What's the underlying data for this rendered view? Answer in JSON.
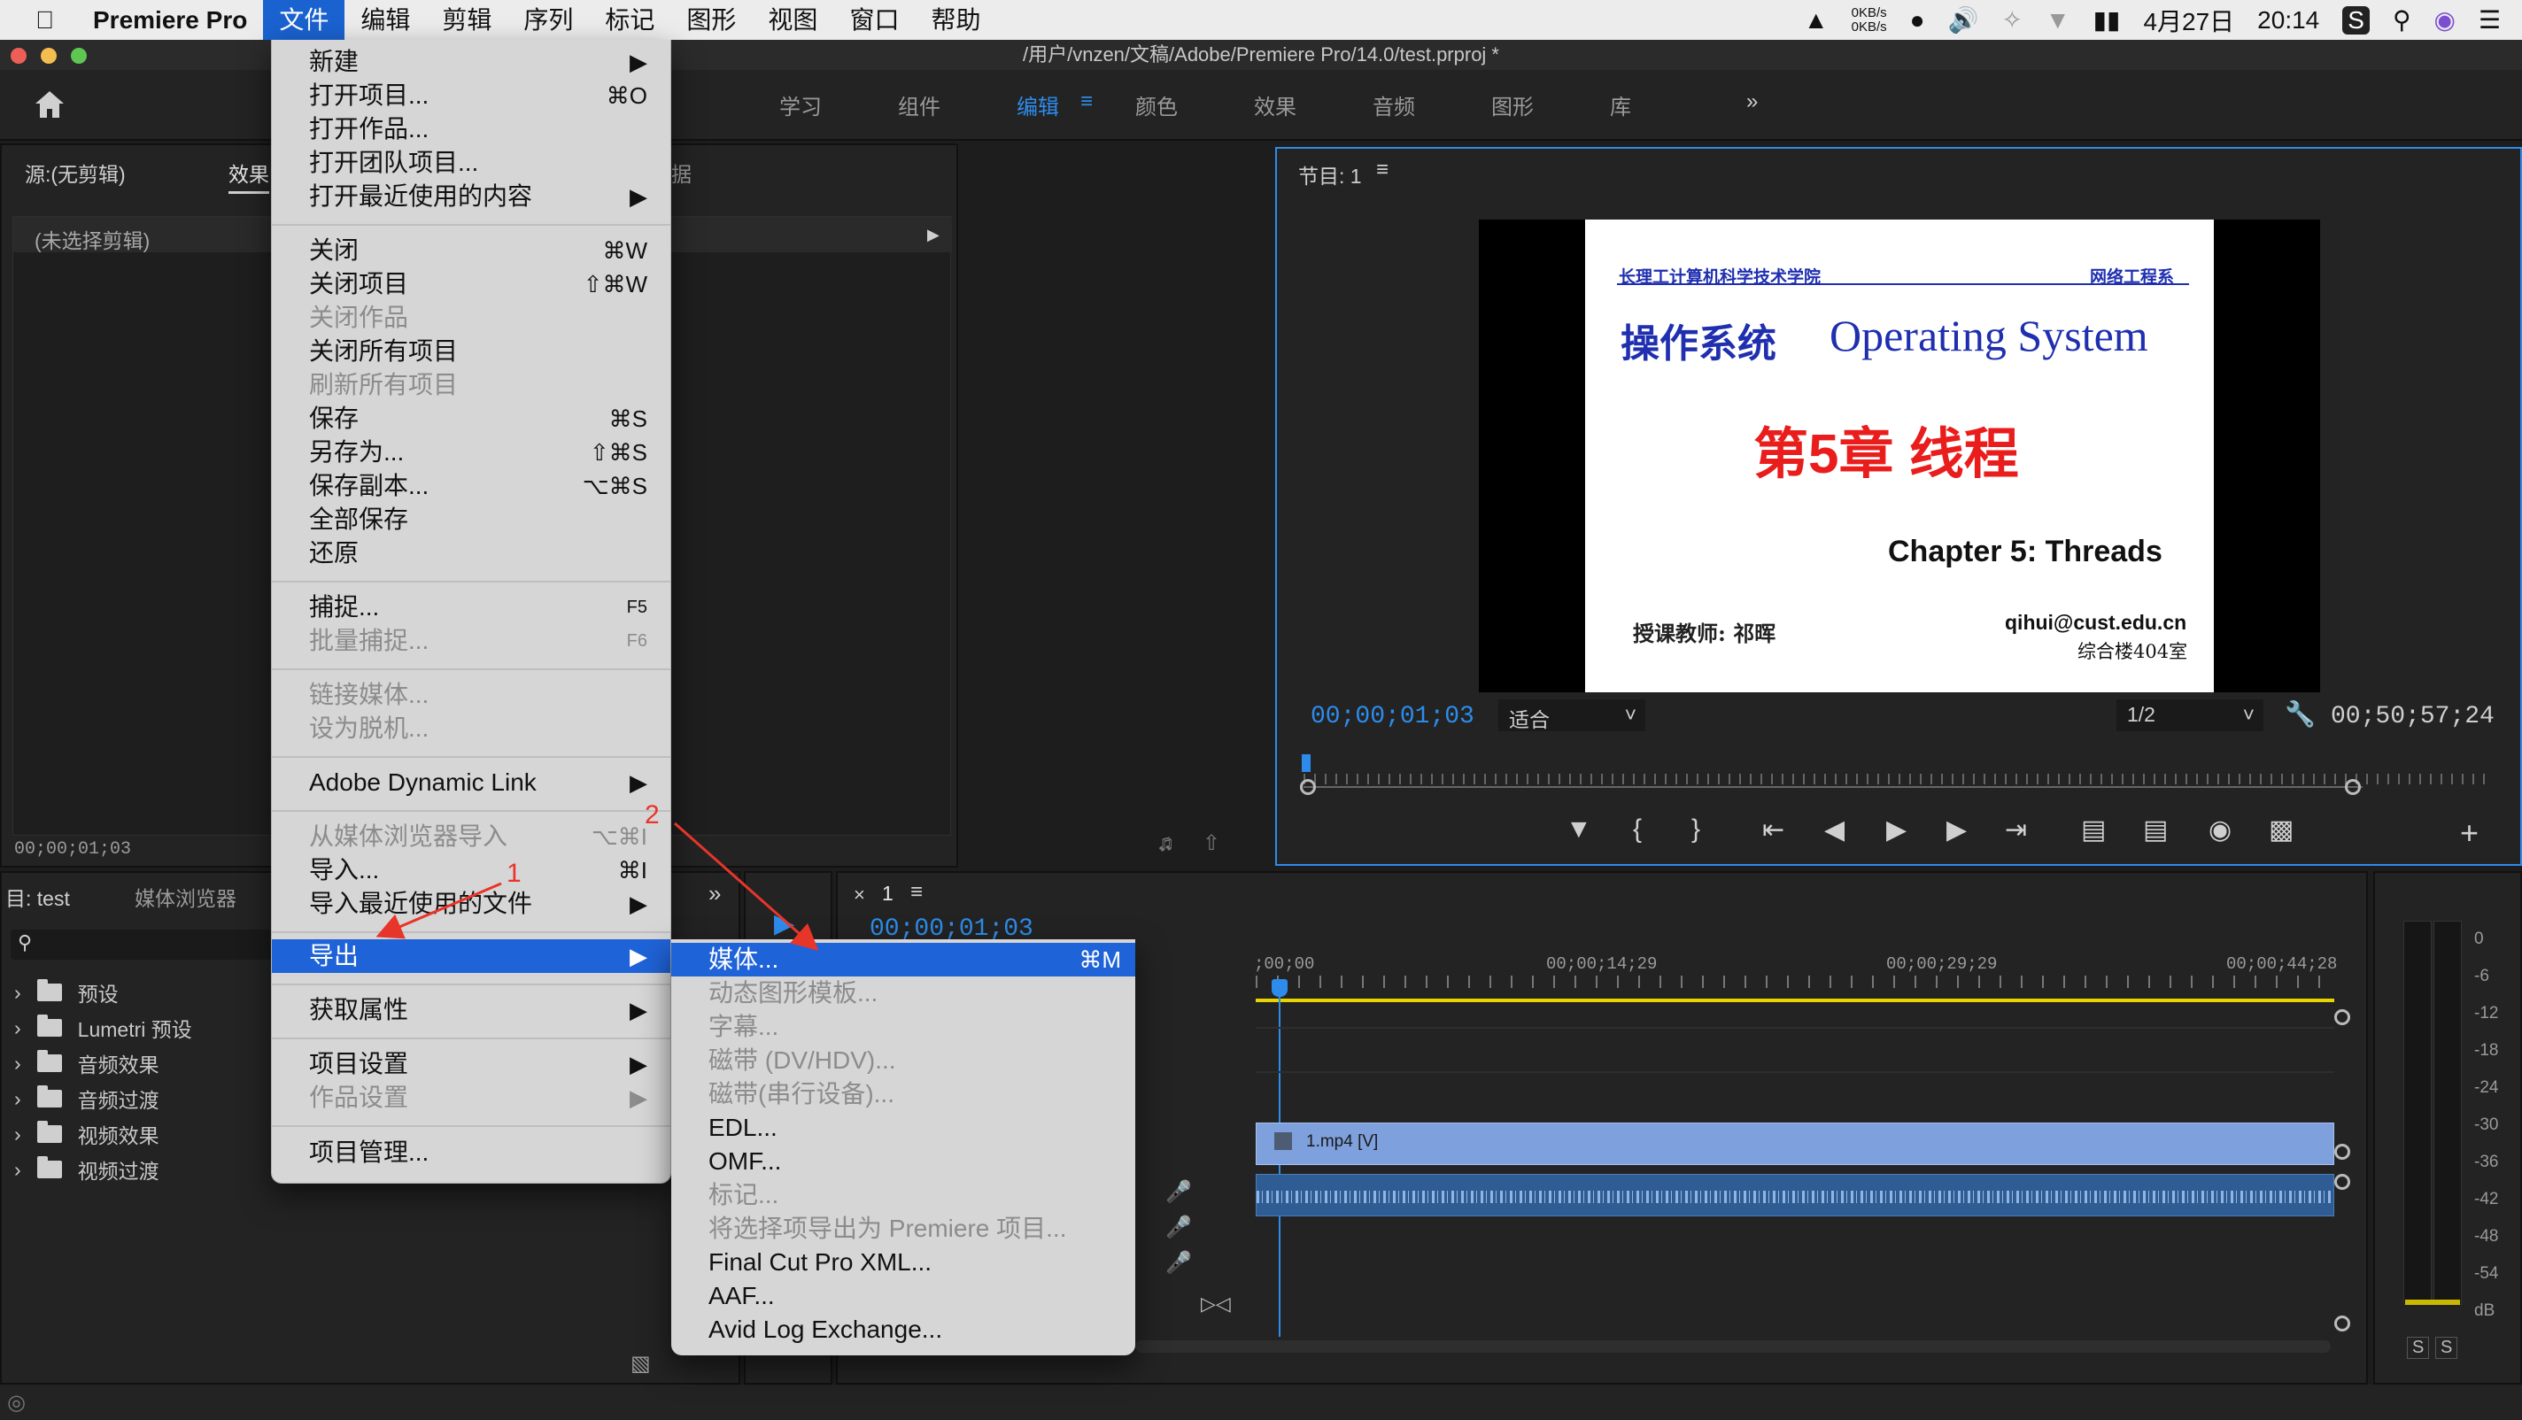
{
  "menubar": {
    "app_name": "Premiere Pro",
    "items": [
      "文件",
      "编辑",
      "剪辑",
      "序列",
      "标记",
      "图形",
      "视图",
      "窗口",
      "帮助"
    ],
    "net_up": "0KB/s",
    "net_down": "0KB/s",
    "date": "4月27日",
    "time": "20:14"
  },
  "window": {
    "title": "/用户/vnzen/文稿/Adobe/Premiere Pro/14.0/test.prproj *"
  },
  "workspaces": {
    "items": [
      "学习",
      "组件",
      "编辑",
      "颜色",
      "效果",
      "音频",
      "图形",
      "库"
    ],
    "active": "编辑",
    "more": "»"
  },
  "source_panel": {
    "tab_source": "源:(无剪辑)",
    "tab_effects": "效果",
    "tab_metadata": "据",
    "no_clip": "(未选择剪辑)",
    "timecode": "00;00;01;03"
  },
  "program_monitor": {
    "title": "节目: 1",
    "timecode_left": "00;00;01;03",
    "fit": "适合",
    "resolution": "1/2",
    "timecode_right": "00;50;57;24",
    "slide": {
      "school": "长理工计算机科学技术学院",
      "dept": "网络工程系",
      "title_cn": "操作系统",
      "title_en": "Operating System",
      "chapter_cn": "第5章 线程",
      "chapter_en": "Chapter 5: Threads",
      "teacher": "授课教师: 祁晖",
      "email": "qihui@cust.edu.cn",
      "room": "综合楼404室"
    }
  },
  "project_panel": {
    "tab_project": "目: test",
    "tab_browser": "媒体浏览器",
    "folders": [
      "预设",
      "Lumetri 预设",
      "音频效果",
      "音频过渡",
      "视频效果",
      "视频过渡"
    ]
  },
  "timeline": {
    "sequence": "1",
    "timecode_partial": "00;00;01;03",
    "ruler": [
      ";00;00",
      "00;00;14;29",
      "00;00;29;29",
      "00;00;44;28"
    ],
    "video_clip": "1.mp4 [V]"
  },
  "meter": {
    "labels": [
      "0",
      "-6",
      "-12",
      "-18",
      "-24",
      "-30",
      "-36",
      "-42",
      "-48",
      "-54",
      "dB"
    ],
    "solo": "S"
  },
  "file_menu": {
    "groups": [
      [
        {
          "label": "新建",
          "shortcut": "▶"
        },
        {
          "label": "打开项目...",
          "shortcut": "⌘O"
        },
        {
          "label": "打开作品...",
          "shortcut": ""
        },
        {
          "label": "打开团队项目...",
          "shortcut": ""
        },
        {
          "label": "打开最近使用的内容",
          "shortcut": "▶"
        }
      ],
      [
        {
          "label": "关闭",
          "shortcut": "⌘W"
        },
        {
          "label": "关闭项目",
          "shortcut": "⇧⌘W"
        },
        {
          "label": "关闭作品",
          "shortcut": "",
          "disabled": true
        },
        {
          "label": "关闭所有项目",
          "shortcut": ""
        },
        {
          "label": "刷新所有项目",
          "shortcut": "",
          "disabled": true
        },
        {
          "label": "保存",
          "shortcut": "⌘S"
        },
        {
          "label": "另存为...",
          "shortcut": "⇧⌘S"
        },
        {
          "label": "保存副本...",
          "shortcut": "⌥⌘S"
        },
        {
          "label": "全部保存",
          "shortcut": ""
        },
        {
          "label": "还原",
          "shortcut": ""
        }
      ],
      [
        {
          "label": "捕捉...",
          "shortcut": "F5"
        },
        {
          "label": "批量捕捉...",
          "shortcut": "F6",
          "disabled": true
        }
      ],
      [
        {
          "label": "链接媒体...",
          "shortcut": "",
          "disabled": true
        },
        {
          "label": "设为脱机...",
          "shortcut": "",
          "disabled": true
        }
      ],
      [
        {
          "label": "Adobe Dynamic Link",
          "shortcut": "▶"
        }
      ],
      [
        {
          "label": "从媒体浏览器导入",
          "shortcut": "⌥⌘I",
          "disabled": true
        },
        {
          "label": "导入...",
          "shortcut": "⌘I"
        },
        {
          "label": "导入最近使用的文件",
          "shortcut": "▶"
        }
      ],
      [
        {
          "label": "导出",
          "shortcut": "▶",
          "highlighted": true
        }
      ],
      [
        {
          "label": "获取属性",
          "shortcut": "▶"
        }
      ],
      [
        {
          "label": "项目设置",
          "shortcut": "▶"
        },
        {
          "label": "作品设置",
          "shortcut": "▶",
          "disabled": true
        }
      ],
      [
        {
          "label": "项目管理...",
          "shortcut": ""
        }
      ]
    ]
  },
  "export_menu": [
    {
      "label": "媒体...",
      "shortcut": "⌘M",
      "highlighted": true
    },
    {
      "label": "动态图形模板...",
      "disabled": true
    },
    {
      "label": "字幕...",
      "disabled": true
    },
    {
      "label": "磁带 (DV/HDV)...",
      "disabled": true
    },
    {
      "label": "磁带(串行设备)...",
      "disabled": true
    },
    {
      "label": "EDL..."
    },
    {
      "label": "OMF..."
    },
    {
      "label": "标记...",
      "disabled": true
    },
    {
      "label": "将选择项导出为 Premiere 项目...",
      "disabled": true
    },
    {
      "label": "Final Cut Pro XML..."
    },
    {
      "label": "AAF..."
    },
    {
      "label": "Avid Log Exchange..."
    }
  ],
  "annotations": {
    "arrow1": "1",
    "arrow2": "2",
    "color": "#e8352a"
  }
}
